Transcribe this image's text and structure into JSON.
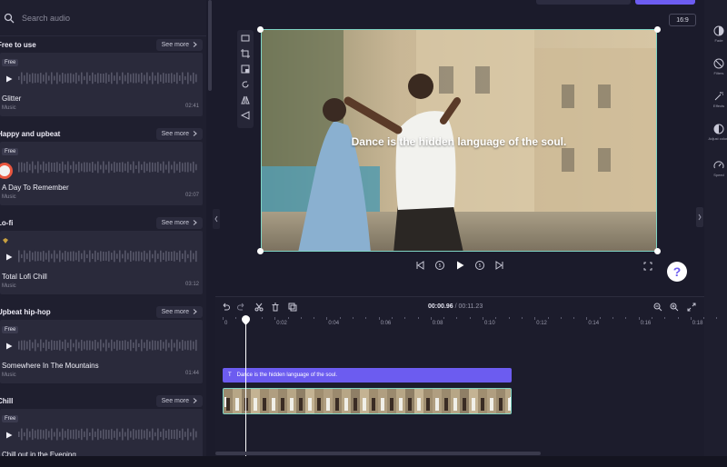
{
  "search": {
    "placeholder": "Search audio"
  },
  "sections": [
    {
      "title": "Free to use",
      "see_more": "See more",
      "badge": "Free",
      "track": "Glitter",
      "genre": "Music",
      "duration": "02:41"
    },
    {
      "title": "Happy and upbeat",
      "see_more": "See more",
      "badge": "Free",
      "track": "A Day To Remember",
      "genre": "Music",
      "duration": "02:07"
    },
    {
      "title": "Lo-fi",
      "see_more": "See more",
      "badge": "",
      "track": "Total Lofi Chill",
      "genre": "Music",
      "duration": "03:12"
    },
    {
      "title": "Upbeat hip-hop",
      "see_more": "See more",
      "badge": "Free",
      "track": "Somewhere In The Mountains",
      "genre": "Music",
      "duration": "01:44"
    },
    {
      "title": "Chill",
      "see_more": "See more",
      "badge": "Free",
      "track": "Chill out in the Evening",
      "genre": "",
      "duration": ""
    }
  ],
  "stage": {
    "aspect_ratio": "16:9",
    "caption": "Dance is the hidden language of the soul."
  },
  "help": {
    "label": "?"
  },
  "right_panel": {
    "items": [
      {
        "label": "Fade",
        "icon": "fade-icon"
      },
      {
        "label": "Filters",
        "icon": "filters-icon"
      },
      {
        "label": "Effects",
        "icon": "effects-icon"
      },
      {
        "label": "Adjust colors",
        "icon": "adjust-colors-icon"
      },
      {
        "label": "Speed",
        "icon": "speed-icon"
      }
    ]
  },
  "timeline": {
    "current_time": "00:00.96",
    "total_time": "/ 00:11.23",
    "ticks": [
      "0",
      "0:02",
      "0:04",
      "0:06",
      "0:08",
      "0:10",
      "0:12",
      "0:14",
      "0:16",
      "0:18"
    ],
    "text_clip": "Dance is the hidden language of the soul.",
    "text_clip_icon": "T"
  },
  "colors": {
    "accent": "#6c5cf0",
    "selection": "#7fd4c4",
    "panel": "#1f1f2f",
    "card": "#2a2a3b"
  }
}
